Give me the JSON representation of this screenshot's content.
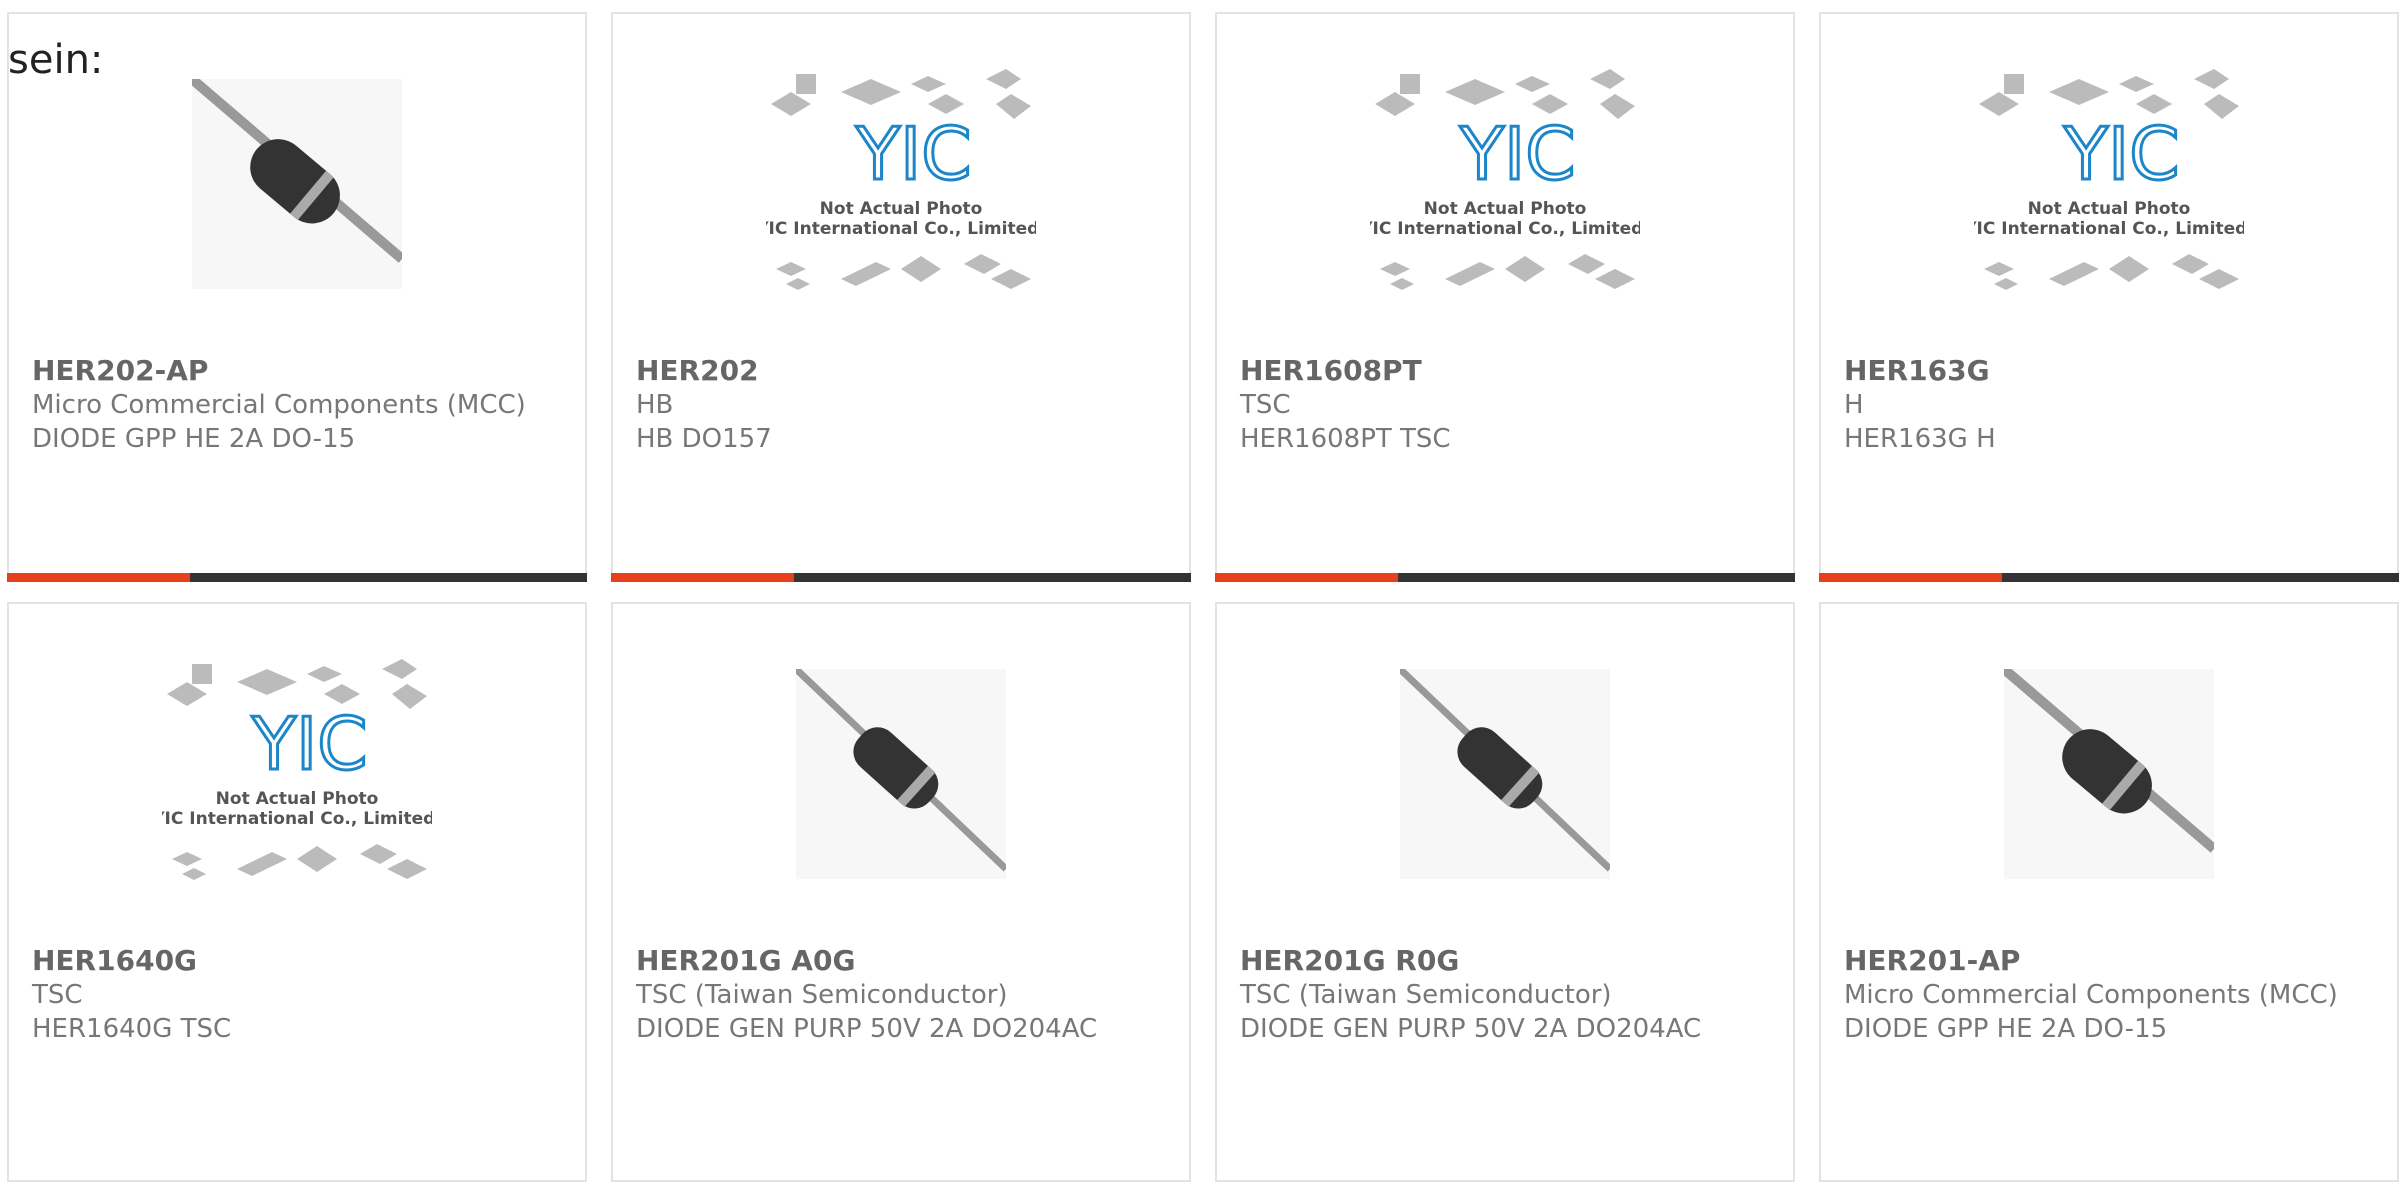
{
  "heading_fragment": "sein:",
  "colors": {
    "accent": "#e8401c",
    "bar": "#333333",
    "yic_blue": "#1c86c8"
  },
  "placeholder": {
    "line1": "Not Actual Photo",
    "line2": "YIC International Co., Limited.",
    "logo": "YIC"
  },
  "products": [
    {
      "name": "HER202-AP",
      "manufacturer": "Micro Commercial Components (MCC)",
      "description": "DIODE GPP HE 2A DO-15",
      "image": "diode-photo"
    },
    {
      "name": "HER202",
      "manufacturer": "HB",
      "description": "HB DO157",
      "image": "placeholder-photo"
    },
    {
      "name": "HER1608PT",
      "manufacturer": "TSC",
      "description": "HER1608PT TSC",
      "image": "placeholder-photo"
    },
    {
      "name": "HER163G",
      "manufacturer": "H",
      "description": "HER163G H",
      "image": "placeholder-photo"
    },
    {
      "name": "HER1640G",
      "manufacturer": "TSC",
      "description": "HER1640G TSC",
      "image": "placeholder-photo"
    },
    {
      "name": "HER201G A0G",
      "manufacturer": "TSC (Taiwan Semiconductor)",
      "description": "DIODE GEN PURP 50V 2A DO204AC",
      "image": "diode-photo"
    },
    {
      "name": "HER201G R0G",
      "manufacturer": "TSC (Taiwan Semiconductor)",
      "description": "DIODE GEN PURP 50V 2A DO204AC",
      "image": "diode-photo"
    },
    {
      "name": "HER201-AP",
      "manufacturer": "Micro Commercial Components (MCC)",
      "description": "DIODE GPP HE 2A DO-15",
      "image": "diode-photo"
    }
  ]
}
